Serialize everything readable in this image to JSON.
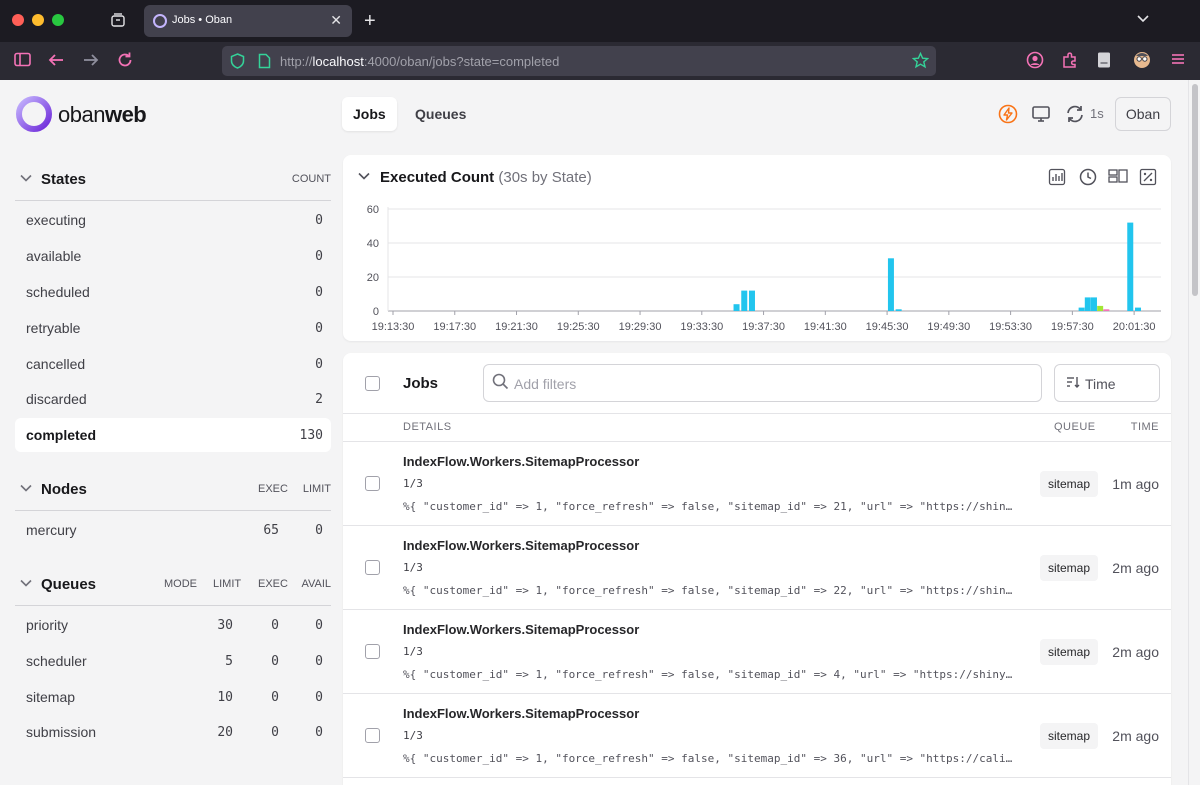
{
  "browser": {
    "tab_title": "Jobs • Oban",
    "url_scheme": "http://",
    "url_host": "localhost",
    "url_rest": ":4000/oban/jobs?state=completed",
    "icons": [
      "sidebar-icon",
      "back-icon",
      "forward-icon",
      "reload-icon",
      "shield-icon",
      "page-icon",
      "bookmark-star-icon",
      "account-icon",
      "extensions-icon",
      "reader-icon",
      "avatar-icon",
      "menu-icon"
    ]
  },
  "app": {
    "logo_text_light": "oban",
    "logo_text_bold": "web",
    "tabs": [
      {
        "label": "Jobs",
        "active": true
      },
      {
        "label": "Queues",
        "active": false
      }
    ],
    "refresh_interval": "1s",
    "instance_button": "Oban"
  },
  "sidebar": {
    "states": {
      "title": "States",
      "column": "COUNT",
      "items": [
        {
          "label": "executing",
          "count": "0"
        },
        {
          "label": "available",
          "count": "0"
        },
        {
          "label": "scheduled",
          "count": "0"
        },
        {
          "label": "retryable",
          "count": "0"
        },
        {
          "label": "cancelled",
          "count": "0"
        },
        {
          "label": "discarded",
          "count": "2"
        },
        {
          "label": "completed",
          "count": "130",
          "active": true
        }
      ]
    },
    "nodes": {
      "title": "Nodes",
      "columns": [
        "EXEC",
        "LIMIT"
      ],
      "items": [
        {
          "label": "mercury",
          "exec": "65",
          "limit": "0"
        }
      ]
    },
    "queues": {
      "title": "Queues",
      "columns": [
        "MODE",
        "LIMIT",
        "EXEC",
        "AVAIL"
      ],
      "items": [
        {
          "label": "priority",
          "limit": "30",
          "exec": "0",
          "avail": "0"
        },
        {
          "label": "scheduler",
          "limit": "5",
          "exec": "0",
          "avail": "0"
        },
        {
          "label": "sitemap",
          "limit": "10",
          "exec": "0",
          "avail": "0"
        },
        {
          "label": "submission",
          "limit": "20",
          "exec": "0",
          "avail": "0"
        }
      ]
    }
  },
  "chart_data": {
    "type": "bar",
    "title": "Executed Count",
    "subtitle": "(30s by State)",
    "ylim": [
      0,
      60
    ],
    "yticks": [
      0,
      20,
      40,
      60
    ],
    "grid": true,
    "xlim": [
      0,
      190
    ],
    "xticks": [
      {
        "t": 0,
        "label": "19:13:30"
      },
      {
        "t": 8,
        "label": "19:17:30"
      },
      {
        "t": 16,
        "label": "19:21:30"
      },
      {
        "t": 24,
        "label": "19:25:30"
      },
      {
        "t": 32,
        "label": "19:29:30"
      },
      {
        "t": 40,
        "label": "19:33:30"
      },
      {
        "t": 48,
        "label": "19:37:30"
      },
      {
        "t": 56,
        "label": "19:41:30"
      },
      {
        "t": 64,
        "label": "19:45:30"
      },
      {
        "t": 72,
        "label": "19:49:30"
      },
      {
        "t": 80,
        "label": "19:53:30"
      },
      {
        "t": 88,
        "label": "19:57:30"
      },
      {
        "t": 96,
        "label": "20:01:30"
      }
    ],
    "bars": [
      {
        "t": 44.5,
        "value": 4,
        "color": "#22c5ee"
      },
      {
        "t": 45.5,
        "value": 12,
        "color": "#22c5ee"
      },
      {
        "t": 46.5,
        "value": 12,
        "color": "#22c5ee"
      },
      {
        "t": 64.5,
        "value": 31,
        "color": "#22c5ee"
      },
      {
        "t": 65.5,
        "value": 1,
        "color": "#22c5ee"
      },
      {
        "t": 89.2,
        "value": 2,
        "color": "#22c5ee"
      },
      {
        "t": 90.0,
        "value": 8,
        "color": "#22c5ee"
      },
      {
        "t": 90.8,
        "value": 8,
        "color": "#22c5ee"
      },
      {
        "t": 91.6,
        "value": 3,
        "color": "#a3e635"
      },
      {
        "t": 92.4,
        "value": 1,
        "color": "#f472b6"
      },
      {
        "t": 95.5,
        "value": 52,
        "color": "#22c5ee"
      },
      {
        "t": 96.5,
        "value": 2,
        "color": "#22c5ee"
      }
    ],
    "icons": [
      "bar-chart-icon",
      "clock-icon",
      "layout-icon",
      "percent-icon"
    ]
  },
  "jobs": {
    "title": "Jobs",
    "filter_placeholder": "Add filters",
    "sort_label": "Time",
    "columns": {
      "details": "DETAILS",
      "queue": "QUEUE",
      "time": "TIME"
    },
    "rows": [
      {
        "worker": "IndexFlow.Workers.SitemapProcessor",
        "attempt": "1/3",
        "args": "%{ \"customer_id\" => 1, \"force_refresh\" => false, \"sitemap_id\" => 21, \"url\" => \"https://shin…",
        "queue": "sitemap",
        "time": "1m ago"
      },
      {
        "worker": "IndexFlow.Workers.SitemapProcessor",
        "attempt": "1/3",
        "args": "%{ \"customer_id\" => 1, \"force_refresh\" => false, \"sitemap_id\" => 22, \"url\" => \"https://shin…",
        "queue": "sitemap",
        "time": "2m ago"
      },
      {
        "worker": "IndexFlow.Workers.SitemapProcessor",
        "attempt": "1/3",
        "args": "%{ \"customer_id\" => 1, \"force_refresh\" => false, \"sitemap_id\" => 4, \"url\" => \"https://shiny…",
        "queue": "sitemap",
        "time": "2m ago"
      },
      {
        "worker": "IndexFlow.Workers.SitemapProcessor",
        "attempt": "1/3",
        "args": "%{ \"customer_id\" => 1, \"force_refresh\" => false, \"sitemap_id\" => 36, \"url\" => \"https://cali…",
        "queue": "sitemap",
        "time": "2m ago"
      }
    ]
  }
}
